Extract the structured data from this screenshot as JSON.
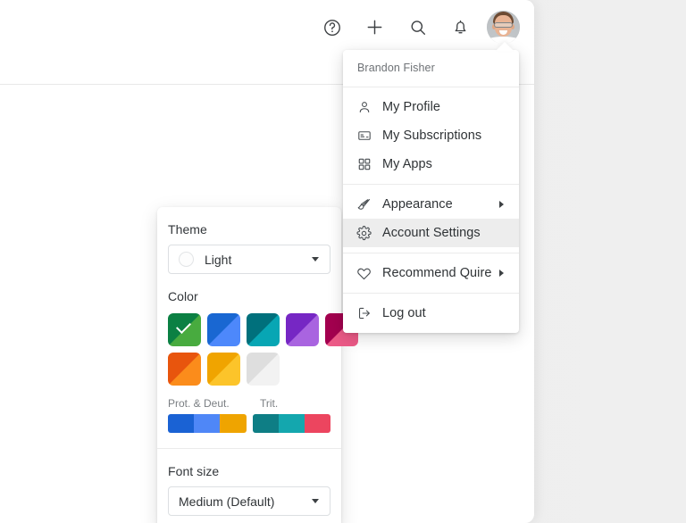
{
  "toolbar": {
    "icons": [
      {
        "name": "help-icon",
        "label": "Help"
      },
      {
        "name": "plus-icon",
        "label": "Add"
      },
      {
        "name": "search-icon",
        "label": "Search"
      },
      {
        "name": "bell-icon",
        "label": "Notifications"
      }
    ],
    "avatar_label": "Brandon Fisher"
  },
  "profile_menu": {
    "username": "Brandon Fisher",
    "groups": [
      {
        "items": [
          {
            "label": "My Profile",
            "icon": "user-icon",
            "arrow": false,
            "active": false
          },
          {
            "label": "My Subscriptions",
            "icon": "card-icon",
            "arrow": false,
            "active": false
          },
          {
            "label": "My Apps",
            "icon": "grid-icon",
            "arrow": false,
            "active": false
          }
        ]
      },
      {
        "items": [
          {
            "label": "Appearance",
            "icon": "brush-icon",
            "arrow": true,
            "active": false
          },
          {
            "label": "Account Settings",
            "icon": "gear-icon",
            "arrow": false,
            "active": true
          }
        ]
      },
      {
        "items": [
          {
            "label": "Recommend Quire",
            "icon": "heart-icon",
            "arrow": true,
            "active": false
          }
        ]
      },
      {
        "items": [
          {
            "label": "Log out",
            "icon": "logout-icon",
            "arrow": false,
            "active": false
          }
        ]
      }
    ]
  },
  "appearance_panel": {
    "theme_label": "Theme",
    "theme_value": "Light",
    "color_label": "Color",
    "colors": [
      {
        "name": "green",
        "from": "#0b8043",
        "to": "#48ab3f",
        "selected": true
      },
      {
        "name": "blue",
        "from": "#1967d2",
        "to": "#4d88fb",
        "selected": false
      },
      {
        "name": "teal",
        "from": "#00707c",
        "to": "#07a6b4",
        "selected": false
      },
      {
        "name": "purple",
        "from": "#7627c4",
        "to": "#a964e0",
        "selected": false
      },
      {
        "name": "pink",
        "from": "#a3004f",
        "to": "#ec5a87",
        "selected": false
      },
      {
        "name": "orange",
        "from": "#e8550d",
        "to": "#fb8c1b",
        "selected": false
      },
      {
        "name": "amber",
        "from": "#f0a400",
        "to": "#fcc42a",
        "selected": false
      },
      {
        "name": "grey",
        "from": "#dedede",
        "to": "#f2f2f2",
        "selected": false
      }
    ],
    "colorblind_labels": [
      "Prot. & Deut.",
      "Trit."
    ],
    "colorblind_bars": [
      {
        "name": "prot-deut-bar",
        "swatches": [
          "#1a62d4",
          "#4f87f7",
          "#efa400"
        ]
      },
      {
        "name": "trit-bar",
        "swatches": [
          "#0e7e85",
          "#14a7ae",
          "#ec455f"
        ]
      }
    ],
    "font_size_label": "Font size",
    "font_size_value": "Medium (Default)"
  }
}
